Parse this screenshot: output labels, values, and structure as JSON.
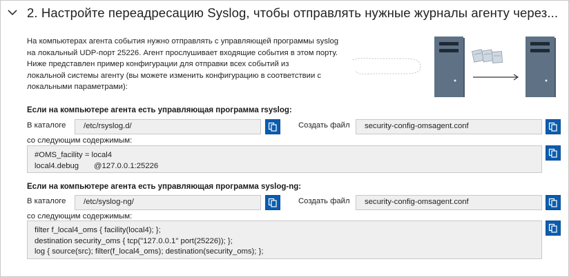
{
  "header": {
    "title": "2. Настройте переадресацию Syslog, чтобы отправлять нужные журналы агенту через..."
  },
  "intro": {
    "lines": [
      "На компьютерах агента события нужно отправлять с управляющей программы syslog",
      "на локальный UDP-порт 25226. Агент прослушивает входящие события в этом порту.",
      "Ниже представлен пример конфигурации для отправки всех событий из",
      "локальной системы агенту (вы можете изменить конфигурацию в соответствии с",
      "локальными параметрами):"
    ]
  },
  "illustration": {
    "icon": "syslog-forwarding-diagram",
    "accent": "#5e7185"
  },
  "rsyslog": {
    "heading": "Если на компьютере агента есть управляющая программа rsyslog:",
    "dir_label": "В каталоге",
    "dir_value": "/etc/rsyslog.d/",
    "file_label": "Создать файл",
    "file_value": "security-config-omsagent.conf",
    "content_label": "со следующим содержимым:",
    "content": [
      "#OMS_facility = local4",
      "local4.debug       @127.0.0.1:25226"
    ]
  },
  "syslogng": {
    "heading": "Если на компьютере агента есть управляющая программа syslog-ng:",
    "dir_label": "В каталоге",
    "dir_value": "/etc/syslog-ng/",
    "file_label": "Создать файл",
    "file_value": "security-config-omsagent.conf",
    "content_label": "со следующим содержимым:",
    "content": [
      "filter f_local4_oms { facility(local4); };",
      "destination security_oms { tcp(\"127.0.0.1\" port(25226)); };",
      "log { source(src); filter(f_local4_oms); destination(security_oms); };"
    ]
  },
  "colors": {
    "copy_button": "#0b5cad",
    "field_bg": "#efefef",
    "field_border": "#c8c8c8"
  }
}
